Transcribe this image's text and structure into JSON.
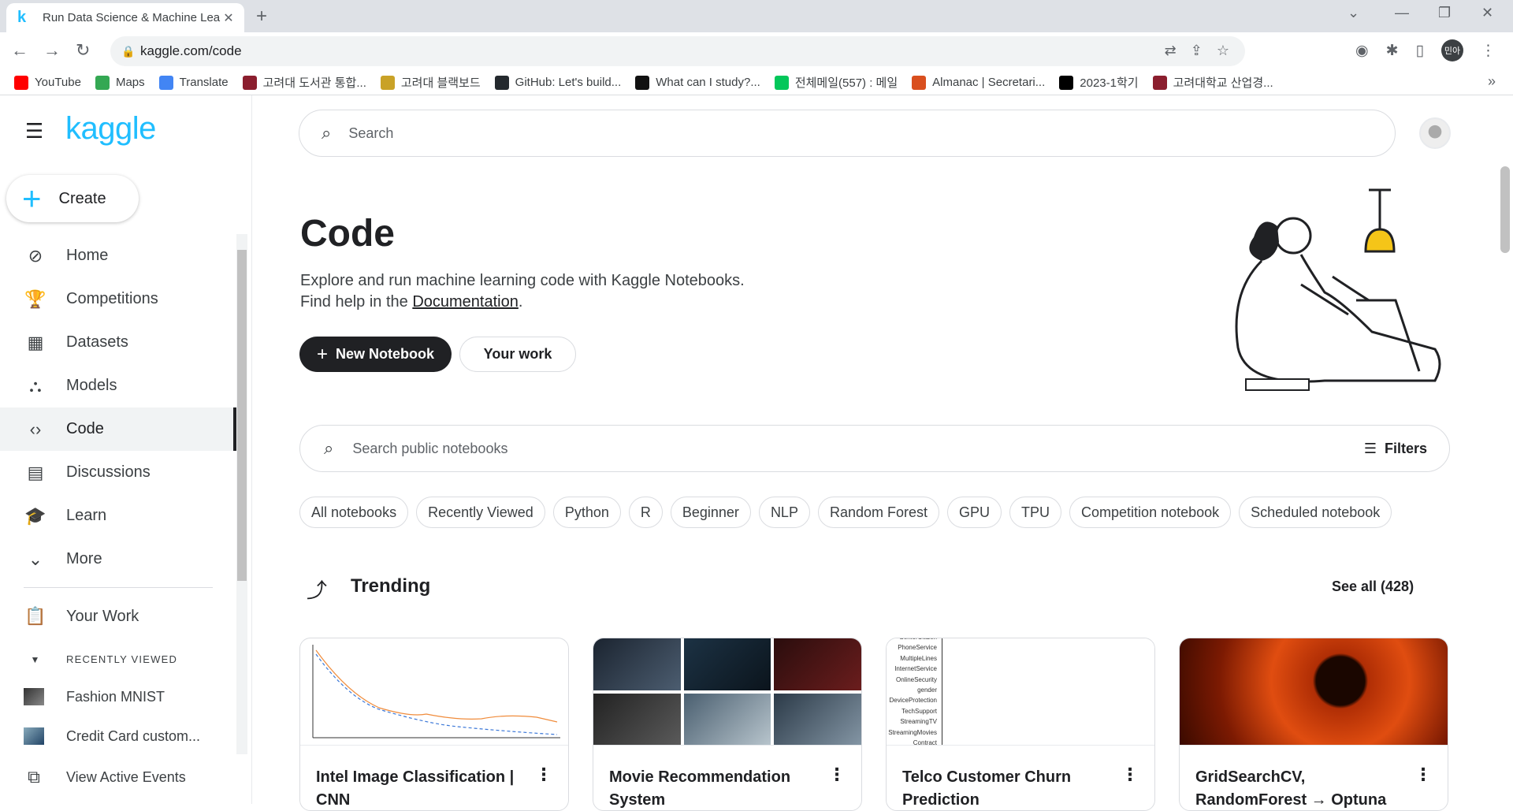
{
  "browser": {
    "tab_title": "Run Data Science & Machine Learning Code Online | Kaggle",
    "url": "kaggle.com/code",
    "profile_initials": "민아",
    "bookmarks": [
      {
        "label": "YouTube",
        "color": "#ff0000"
      },
      {
        "label": "Maps",
        "color": "#34a853"
      },
      {
        "label": "Translate",
        "color": "#4285f4"
      },
      {
        "label": "고려대 도서관 통합...",
        "color": "#8b1e2e"
      },
      {
        "label": "고려대 블랙보드",
        "color": "#c9a227"
      },
      {
        "label": "GitHub: Let's build...",
        "color": "#24292e"
      },
      {
        "label": "What can I study?...",
        "color": "#111111"
      },
      {
        "label": "전체메일(557) : 메일",
        "color": "#03c75a"
      },
      {
        "label": "Almanac | Secretari...",
        "color": "#d94f1e"
      },
      {
        "label": "2023-1학기",
        "color": "#000000"
      },
      {
        "label": "고려대학교 산업경...",
        "color": "#8b1e2e"
      }
    ]
  },
  "sidebar": {
    "logo": "kaggle",
    "create_label": "Create",
    "nav": [
      {
        "label": "Home",
        "icon": "compass-icon",
        "glyph": "⊘"
      },
      {
        "label": "Competitions",
        "icon": "trophy-icon",
        "glyph": "🏆"
      },
      {
        "label": "Datasets",
        "icon": "table-icon",
        "glyph": "▦"
      },
      {
        "label": "Models",
        "icon": "models-icon",
        "glyph": "⛬"
      },
      {
        "label": "Code",
        "icon": "code-icon",
        "glyph": "‹›"
      },
      {
        "label": "Discussions",
        "icon": "discussion-icon",
        "glyph": "▤"
      },
      {
        "label": "Learn",
        "icon": "school-icon",
        "glyph": "🎓"
      },
      {
        "label": "More",
        "icon": "chevron-down-icon",
        "glyph": "⌄"
      }
    ],
    "your_work": "Your Work",
    "recently_viewed_header": "RECENTLY VIEWED",
    "recent": [
      "Fashion MNIST",
      "Credit Card custom..."
    ],
    "view_active_events": "View Active Events"
  },
  "main": {
    "search_placeholder": "Search",
    "title": "Code",
    "desc_line1": "Explore and run machine learning code with Kaggle Notebooks.",
    "desc_line2_prefix": "Find help in the ",
    "desc_link": "Documentation",
    "desc_suffix": ".",
    "new_notebook": "New Notebook",
    "your_work": "Your work",
    "notebook_search_placeholder": "Search public notebooks",
    "filters": "Filters",
    "chips": [
      "All notebooks",
      "Recently Viewed",
      "Python",
      "R",
      "Beginner",
      "NLP",
      "Random Forest",
      "GPU",
      "TPU",
      "Competition notebook",
      "Scheduled notebook"
    ],
    "trending_title": "Trending",
    "see_all": "See all (428)",
    "cards": [
      {
        "title": "Intel Image Classification | CNN"
      },
      {
        "title": "Movie Recommendation System"
      },
      {
        "title": "Telco Customer Churn Prediction",
        "thumb_labels": [
          "SeniorCitizen",
          "PhoneService",
          "MultipleLines",
          "InternetService",
          "OnlineSecurity",
          "gender",
          "DeviceProtection",
          "TechSupport",
          "StreamingTV",
          "StreamingMovies",
          "Contract"
        ]
      },
      {
        "title": "GridSearchCV, RandomForest → Optuna"
      }
    ]
  }
}
